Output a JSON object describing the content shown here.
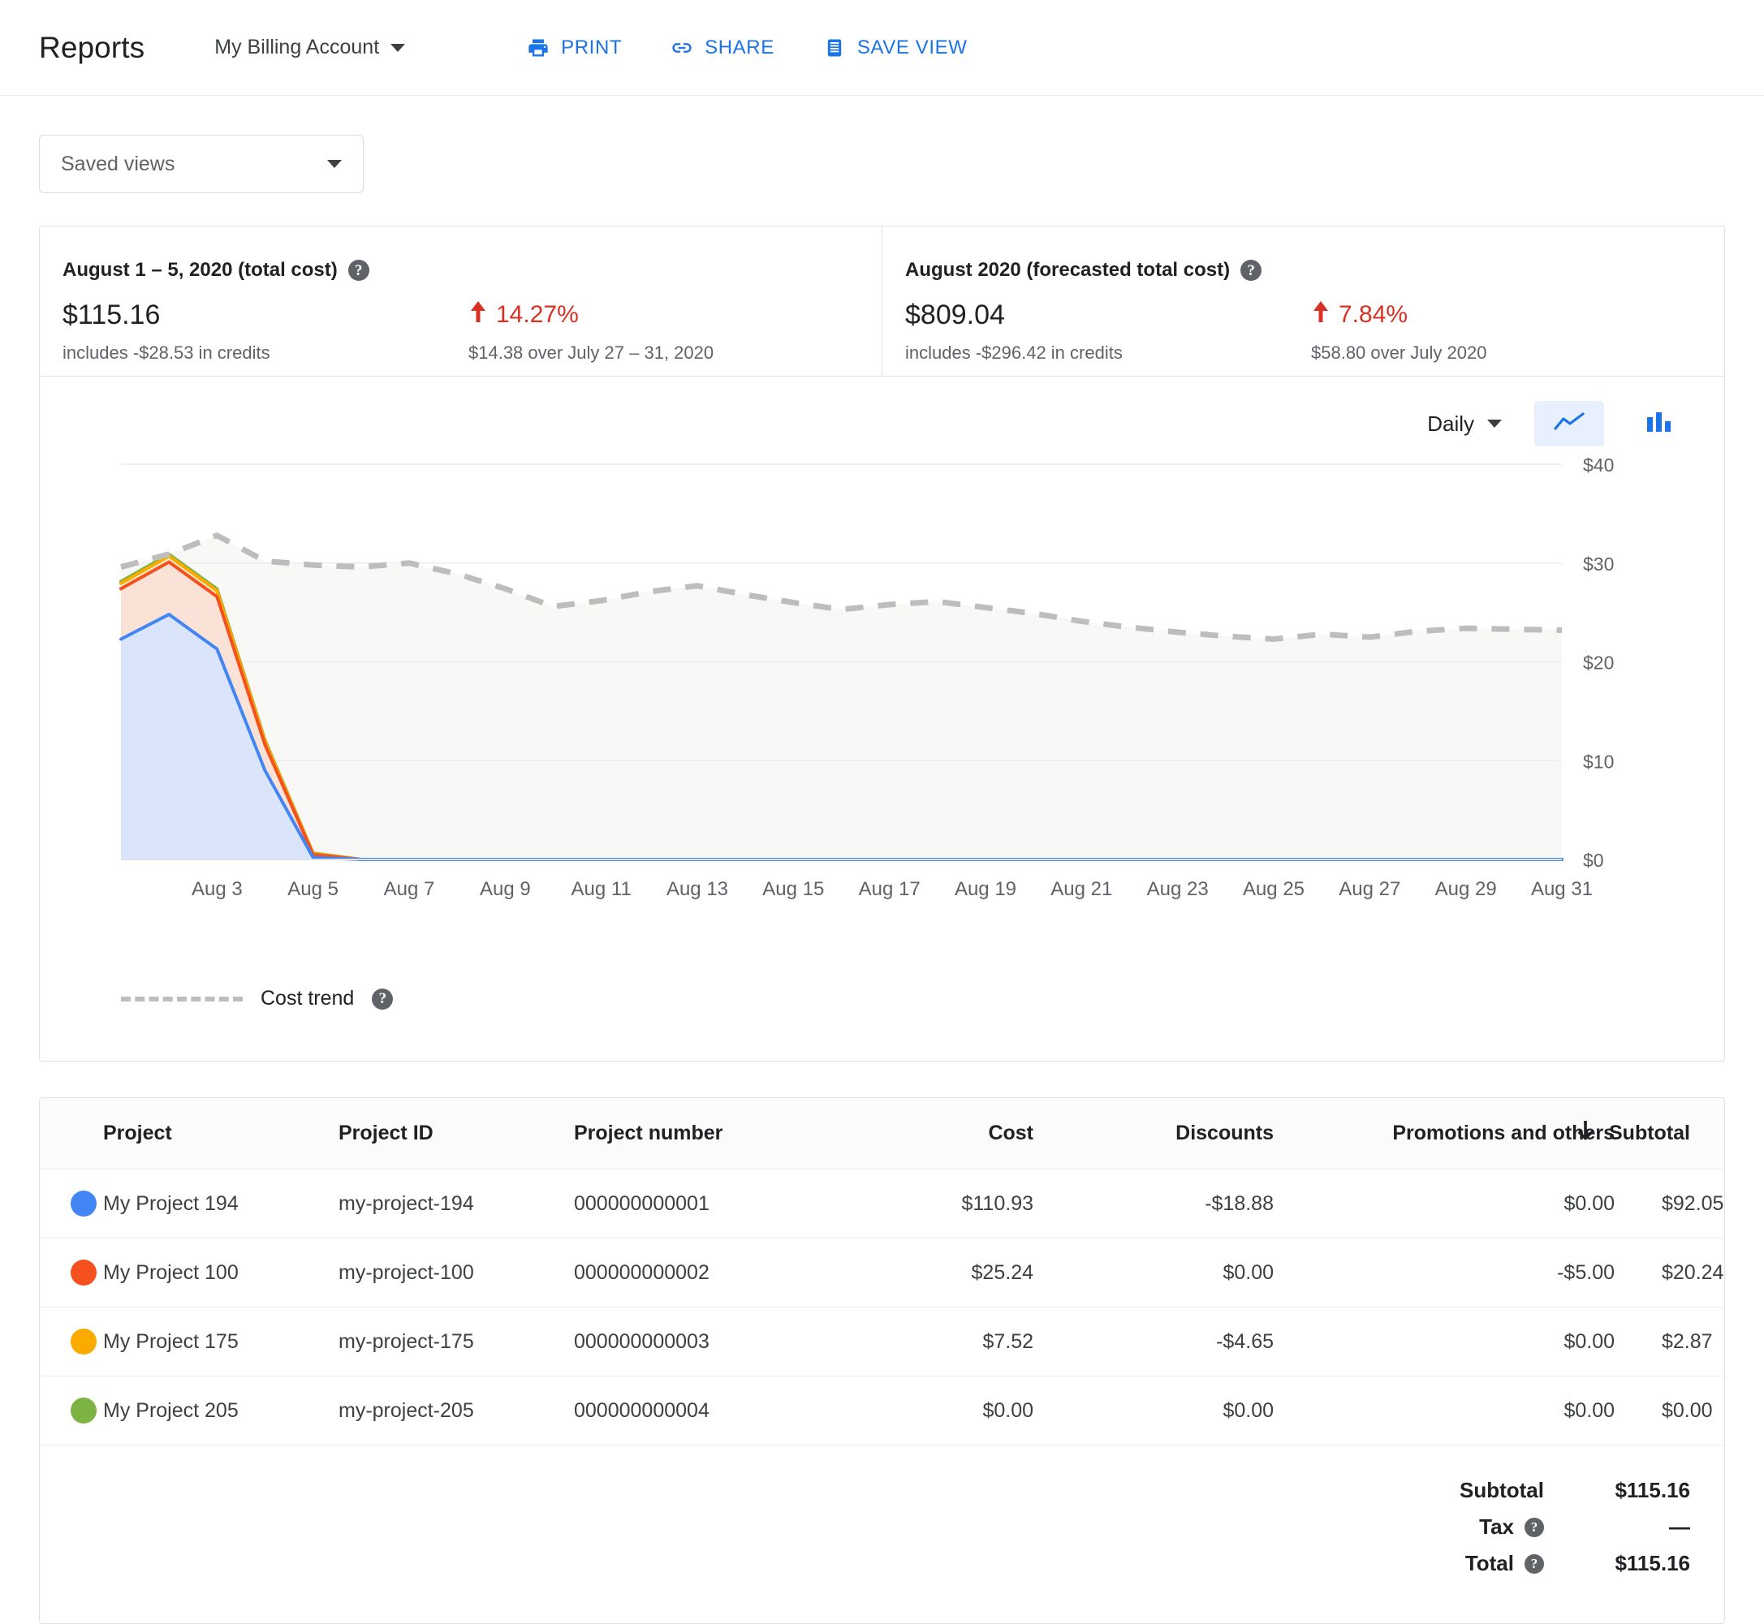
{
  "header": {
    "title": "Reports",
    "account": "My Billing Account",
    "actions": [
      {
        "label": "PRINT",
        "icon": "print-icon"
      },
      {
        "label": "SHARE",
        "icon": "link-icon"
      },
      {
        "label": "SAVE VIEW",
        "icon": "save-view-icon"
      }
    ],
    "link_color": "#1a73e8"
  },
  "saved_views": {
    "label": "Saved views"
  },
  "summary": {
    "cards": [
      {
        "title": "August 1 – 5, 2020 (total cost)",
        "amount": "$115.16",
        "delta": "14.27%",
        "delta_direction": "up",
        "delta_color": "#d93025",
        "credits": "includes -$28.53 in credits",
        "comparison": "$14.38 over July 27 – 31, 2020"
      },
      {
        "title": "August 2020 (forecasted total cost)",
        "amount": "$809.04",
        "delta": "7.84%",
        "delta_direction": "up",
        "delta_color": "#d93025",
        "credits": "includes -$296.42 in credits",
        "comparison": "$58.80 over July 2020"
      }
    ]
  },
  "chart_controls": {
    "granularity": "Daily",
    "line_chart_label": "line-chart",
    "bar_chart_label": "bar-chart",
    "active_type": "line"
  },
  "chart_legend": {
    "label": "Cost trend"
  },
  "chart_data": {
    "type": "area",
    "title": "",
    "xlabel": "",
    "ylabel": "",
    "ylim": [
      0,
      40
    ],
    "yticks": [
      "$0",
      "$10",
      "$20",
      "$30",
      "$40"
    ],
    "ytick_values": [
      0,
      10,
      20,
      30,
      40
    ],
    "grid": true,
    "legend_position": "bottom-left",
    "x": [
      "Aug 1",
      "Aug 2",
      "Aug 3",
      "Aug 4",
      "Aug 5",
      "Aug 6",
      "Aug 7",
      "Aug 8",
      "Aug 9",
      "Aug 10",
      "Aug 11",
      "Aug 12",
      "Aug 13",
      "Aug 14",
      "Aug 15",
      "Aug 16",
      "Aug 17",
      "Aug 18",
      "Aug 19",
      "Aug 20",
      "Aug 21",
      "Aug 22",
      "Aug 23",
      "Aug 24",
      "Aug 25",
      "Aug 26",
      "Aug 27",
      "Aug 28",
      "Aug 29",
      "Aug 30",
      "Aug 31"
    ],
    "xticks": [
      "Aug 3",
      "Aug 5",
      "Aug 7",
      "Aug 9",
      "Aug 11",
      "Aug 13",
      "Aug 15",
      "Aug 17",
      "Aug 19",
      "Aug 21",
      "Aug 23",
      "Aug 25",
      "Aug 27",
      "Aug 29",
      "Aug 31"
    ],
    "stacked": true,
    "series": [
      {
        "name": "My Project 194",
        "color": "#4285f4",
        "fill": "#d8e4fb",
        "values": [
          22.3,
          24.8,
          21.3,
          9.0,
          0.2,
          0,
          0,
          0,
          0,
          0,
          0,
          0,
          0,
          0,
          0,
          0,
          0,
          0,
          0,
          0,
          0,
          0,
          0,
          0,
          0,
          0,
          0,
          0,
          0,
          0,
          0
        ]
      },
      {
        "name": "My Project 100",
        "color": "#f4511e",
        "fill": "#fbe0d4",
        "values": [
          5.1,
          5.3,
          5.3,
          2.6,
          0.3,
          0,
          0,
          0,
          0,
          0,
          0,
          0,
          0,
          0,
          0,
          0,
          0,
          0,
          0,
          0,
          0,
          0,
          0,
          0,
          0,
          0,
          0,
          0,
          0,
          0,
          0
        ]
      },
      {
        "name": "My Project 175",
        "color": "#fbab00",
        "fill": "#fdeec9",
        "values": [
          0.55,
          0.6,
          0.6,
          0.35,
          0.1,
          0,
          0,
          0,
          0,
          0,
          0,
          0,
          0,
          0,
          0,
          0,
          0,
          0,
          0,
          0,
          0,
          0,
          0,
          0,
          0,
          0,
          0,
          0,
          0,
          0,
          0
        ]
      },
      {
        "name": "My Project 205",
        "color": "#7cb342",
        "fill": "#e3eed7",
        "values": [
          0.18,
          0.18,
          0.18,
          0.12,
          0.05,
          0,
          0,
          0,
          0,
          0,
          0,
          0,
          0,
          0,
          0,
          0,
          0,
          0,
          0,
          0,
          0,
          0,
          0,
          0,
          0,
          0,
          0,
          0,
          0,
          0,
          0
        ]
      }
    ],
    "trend": {
      "name": "Cost trend",
      "color": "#bdbdbd",
      "style": "dashed",
      "values": [
        29.6,
        30.9,
        32.8,
        30.2,
        29.8,
        29.6,
        30.0,
        28.9,
        27.4,
        25.6,
        26.2,
        27.1,
        27.7,
        26.8,
        26.0,
        25.3,
        25.8,
        26.1,
        25.5,
        24.9,
        24.1,
        23.5,
        23.0,
        22.6,
        22.3,
        22.8,
        22.5,
        23.1,
        23.4,
        23.3,
        23.2
      ]
    }
  },
  "table": {
    "columns": [
      {
        "key": "swatch",
        "label": ""
      },
      {
        "key": "project",
        "label": "Project"
      },
      {
        "key": "project_id",
        "label": "Project ID"
      },
      {
        "key": "project_number",
        "label": "Project number"
      },
      {
        "key": "cost",
        "label": "Cost"
      },
      {
        "key": "discounts",
        "label": "Discounts"
      },
      {
        "key": "promotions",
        "label": "Promotions and others"
      },
      {
        "key": "subtotal",
        "label": "Subtotal"
      }
    ],
    "sort_column": "Subtotal",
    "sort_direction": "desc",
    "rows": [
      {
        "color": "#4285f4",
        "project": "My Project 194",
        "project_id": "my-project-194",
        "project_number": "000000000001",
        "cost": "$110.93",
        "discounts": "-$18.88",
        "promotions": "$0.00",
        "subtotal": "$92.05"
      },
      {
        "color": "#f4511e",
        "project": "My Project 100",
        "project_id": "my-project-100",
        "project_number": "000000000002",
        "cost": "$25.24",
        "discounts": "$0.00",
        "promotions": "-$5.00",
        "subtotal": "$20.24"
      },
      {
        "color": "#fbab00",
        "project": "My Project 175",
        "project_id": "my-project-175",
        "project_number": "000000000003",
        "cost": "$7.52",
        "discounts": "-$4.65",
        "promotions": "$0.00",
        "subtotal": "$2.87"
      },
      {
        "color": "#7cb342",
        "project": "My Project 205",
        "project_id": "my-project-205",
        "project_number": "000000000004",
        "cost": "$0.00",
        "discounts": "$0.00",
        "promotions": "$0.00",
        "subtotal": "$0.00"
      }
    ],
    "totals": [
      {
        "label": "Subtotal",
        "value": "$115.16",
        "help": false
      },
      {
        "label": "Tax",
        "value": "—",
        "help": true
      },
      {
        "label": "Total",
        "value": "$115.16",
        "help": true
      }
    ]
  }
}
